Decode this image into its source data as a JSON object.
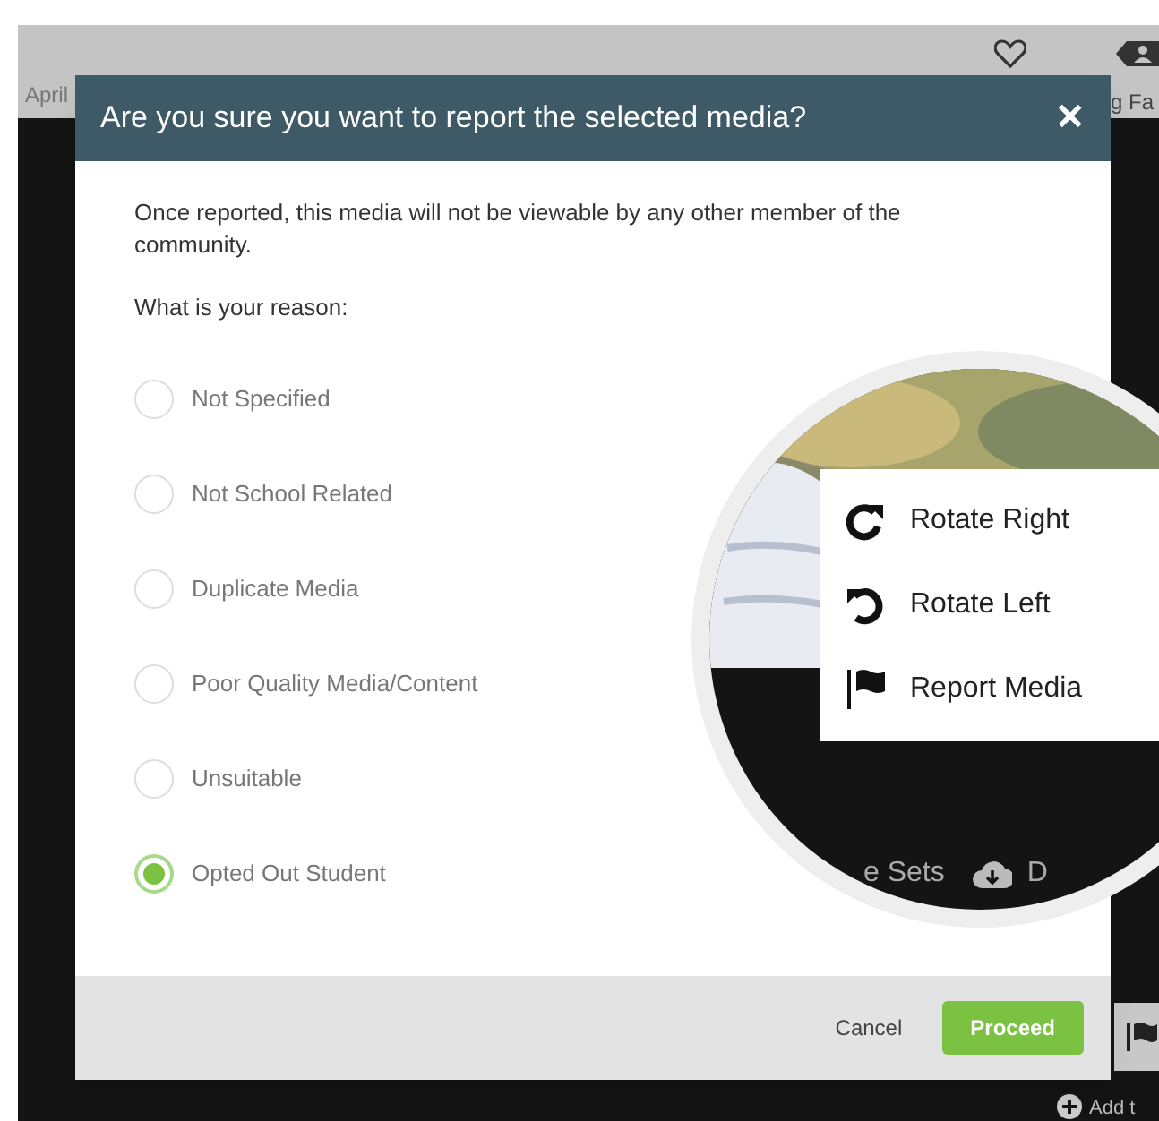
{
  "background": {
    "date": "April",
    "tag_label": "g Fa",
    "add_label": "Add t"
  },
  "dialog": {
    "title": "Are you sure you want to report the selected media?",
    "close": "✕",
    "message": "Once reported, this media will not be viewable by any other member of the community.",
    "question": "What is your reason:",
    "reasons": [
      {
        "label": "Not Specified",
        "selected": false
      },
      {
        "label": "Not School Related",
        "selected": false
      },
      {
        "label": "Duplicate Media",
        "selected": false
      },
      {
        "label": "Poor Quality Media/Content",
        "selected": false
      },
      {
        "label": "Unsuitable",
        "selected": false
      },
      {
        "label": "Opted Out Student",
        "selected": true
      }
    ],
    "buttons": [
      {
        "label": "Cancel",
        "kind": "plain"
      },
      {
        "label": "Proceed",
        "kind": "primary"
      }
    ]
  },
  "magnifier": {
    "menu": [
      {
        "label": "Rotate Right",
        "kind": "rotate-right"
      },
      {
        "label": "Rotate Left",
        "kind": "rotate-left"
      },
      {
        "label": "Report Media",
        "kind": "flag"
      }
    ],
    "toolbar": [
      {
        "label": "e Sets",
        "kind": "text"
      },
      {
        "label": "D",
        "kind": "download"
      }
    ]
  }
}
